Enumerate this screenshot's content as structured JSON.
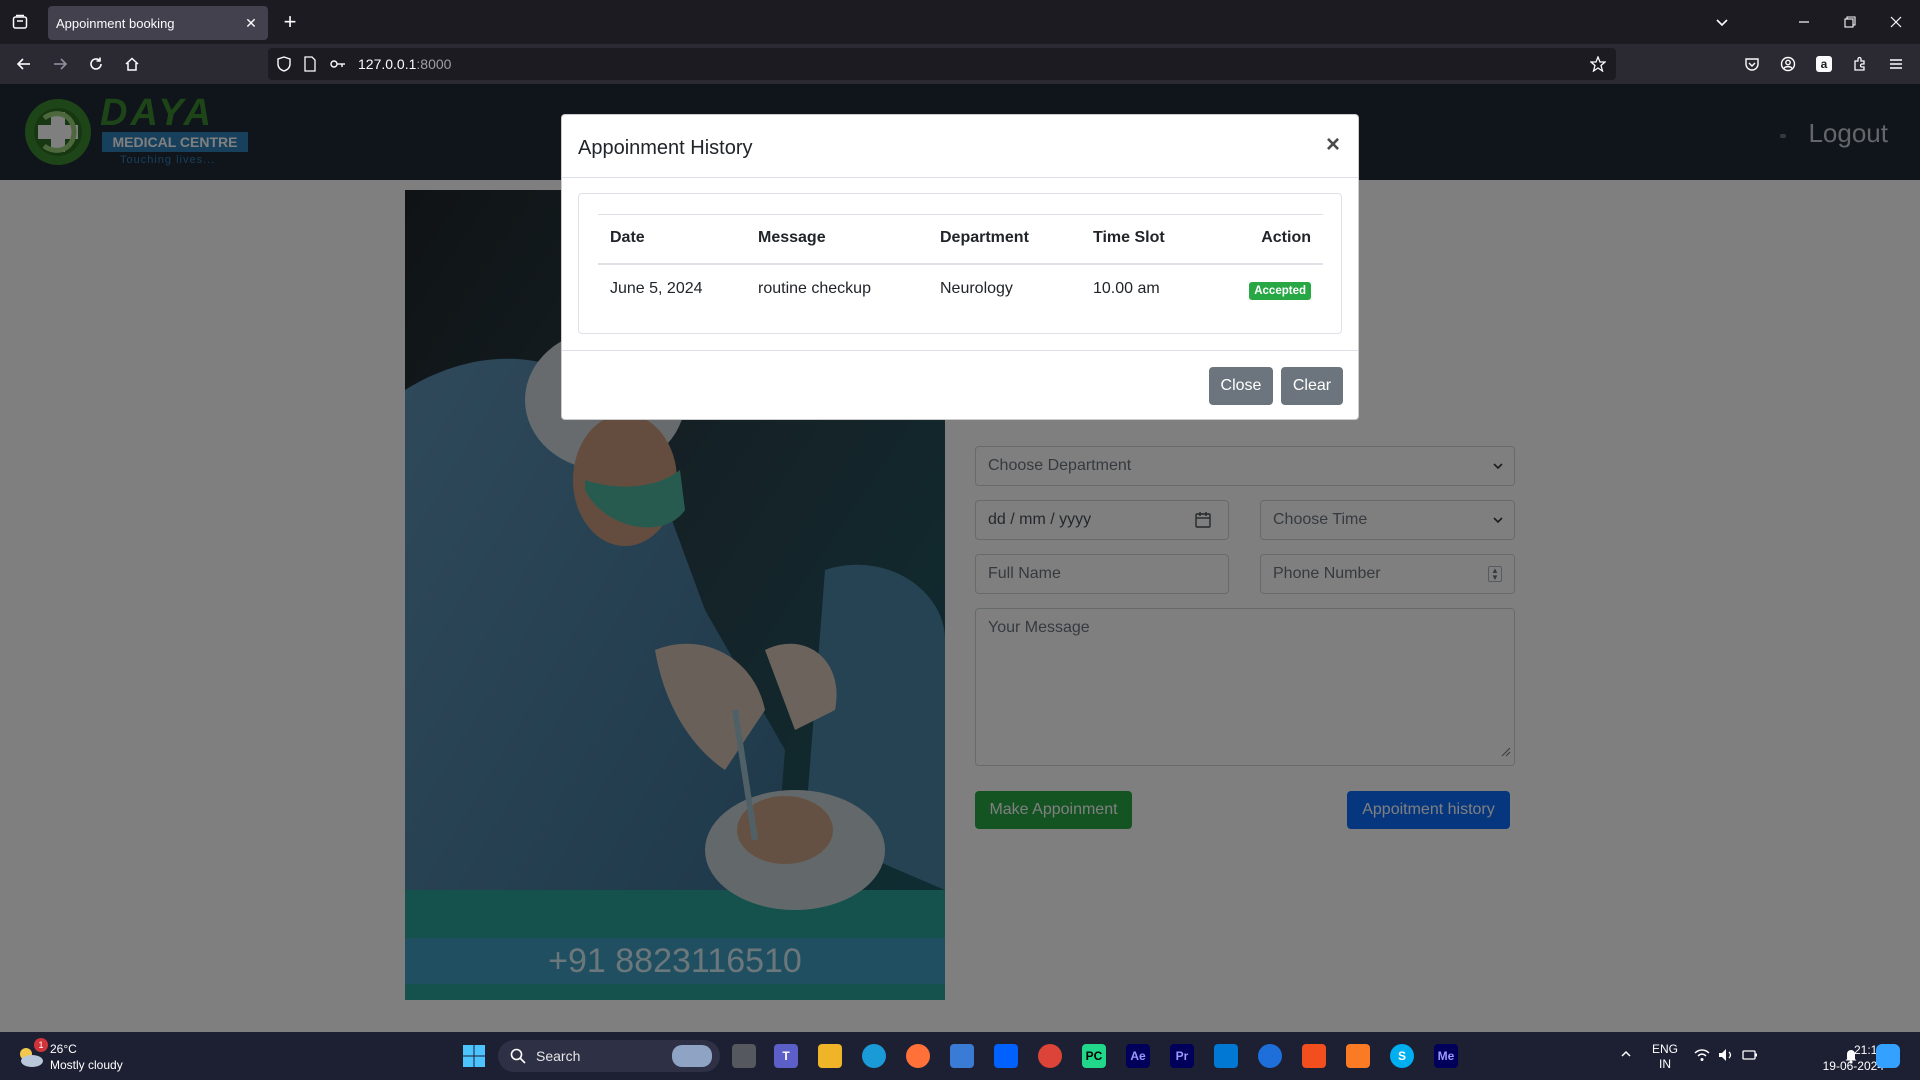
{
  "browser": {
    "tab_title": "Appoinment booking",
    "url_host": "127.0.0.1",
    "url_port": ":8000"
  },
  "site": {
    "logo_line1": "DAYA",
    "logo_line2": "MEDICAL CENTRE",
    "logo_tagline": "Touching lives...",
    "logout": "Logout",
    "phone": "+91 8823116510"
  },
  "form": {
    "department_placeholder": "Choose Department",
    "date_placeholder": "dd / mm / yyyy",
    "time_placeholder": "Choose Time",
    "name_placeholder": "Full Name",
    "phone_placeholder": "Phone Number",
    "message_placeholder": "Your Message",
    "make_button": "Make Appoinment",
    "history_button": "Appoitment history"
  },
  "modal": {
    "title": "Appoinment History",
    "columns": [
      "Date",
      "Message",
      "Department",
      "Time Slot",
      "Action"
    ],
    "rows": [
      {
        "date": "June 5, 2024",
        "message": "routine checkup",
        "department": "Neurology",
        "time_slot": "10.00 am",
        "status": "Accepted"
      }
    ],
    "close_button": "Close",
    "clear_button": "Clear"
  },
  "taskbar": {
    "weather_temp": "26°C",
    "weather_desc": "Mostly cloudy",
    "weather_badge": "1",
    "search_label": "Search",
    "lang_line1": "ENG",
    "lang_line2": "IN",
    "time": "21:15",
    "date": "19-06-2024",
    "apps": [
      "Ae",
      "Pr",
      "Me"
    ]
  },
  "colors": {
    "accent_green": "#28a745",
    "accent_blue": "#0d6efd",
    "secondary": "#6c757d",
    "header_dark": "#1f2a37"
  }
}
